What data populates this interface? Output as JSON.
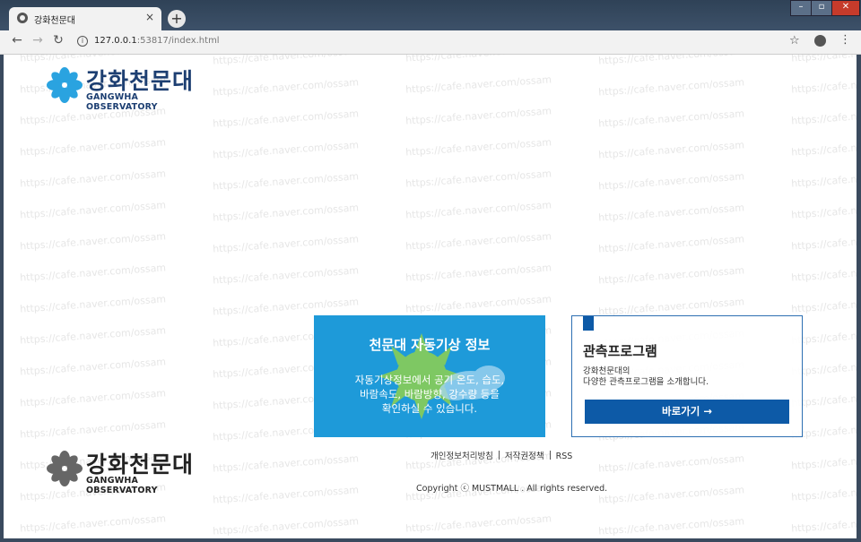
{
  "browser": {
    "tab_title": "강화천문대",
    "tab_close": "×",
    "new_tab": "+",
    "url_host": "127.0.0.1",
    "url_rest": ":53817/index.html",
    "window_min": "–",
    "window_max": "▫",
    "window_close": "✕"
  },
  "watermark": "https://cafe.naver.com/ossam",
  "header": {
    "logo_title": "강화천문대",
    "logo_subtitle": "GANGWHA OBSERVATORY"
  },
  "weather": {
    "title": "천문대 자동기상 정보",
    "description_line1": "자동기상정보에서 공기 온도, 습도,",
    "description_line2": "바람속도, 바람방향, 강수량 등을",
    "description_line3": "확인하실 수 있습니다."
  },
  "program": {
    "title": "관측프로그램",
    "description_line1": "강화천문대의",
    "description_line2": "다양한 관측프로그램을 소개합니다.",
    "button_label": "바로가기 →"
  },
  "footer": {
    "logo_title": "강화천문대",
    "logo_subtitle": "GANGWHA OBSERVATORY",
    "links": [
      "개인정보처리방침",
      "저작권정책",
      "RSS"
    ],
    "copyright": "Copyright ⓒ MUSTMALL . All rights reserved."
  },
  "colors": {
    "brand_navy": "#1d3f72",
    "brand_blue": "#0d5aa7",
    "weather_blue": "#1e9ad9",
    "logo_cyan": "#2aa3e0"
  }
}
